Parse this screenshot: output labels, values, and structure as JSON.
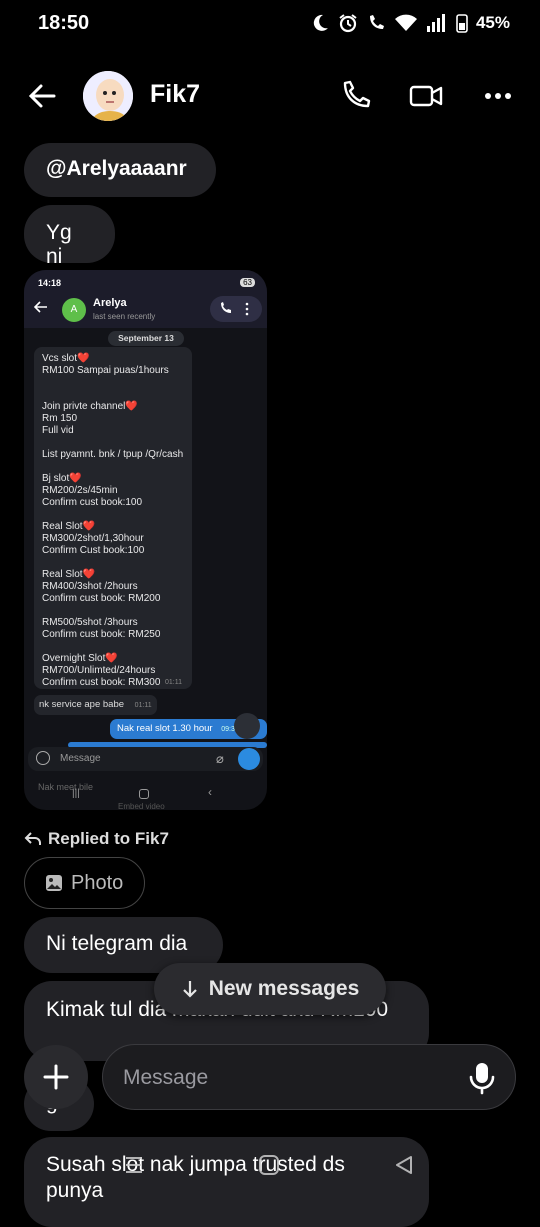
{
  "status": {
    "time": "18:50",
    "battery": "45%"
  },
  "header": {
    "contact_name": "Fik7"
  },
  "messages": {
    "m1": "@Arelyaaaanr",
    "m2": "Yg ni",
    "replied_label": "Replied to Fik7",
    "photo_label": "Photo",
    "m3": "Ni telegram dia",
    "m4": "Kimak tul dia makan duit aku Rm100",
    "m5": "g",
    "m6": "Susah slot nak jumpa trusted ds punya"
  },
  "embedded_screenshot": {
    "time": "14:18",
    "battery": "63",
    "chat_name": "Arelya",
    "chat_status": "last seen recently",
    "avatar_letter": "A",
    "date_chip": "September 13",
    "menu_text": "Vcs slot❤️\nRM100 Sampai puas/1hours\n\n\nJoin privte channel❤️\nRm 150\nFull vid\n\nList pyamnt. bnk / tpup /Qr/cash\n\nBj slot❤️\nRM200/2s/45min\nConfirm cust book:100\n\nReal Slot❤️\nRM300/2shot/1,30hour\nConfirm Cust book:100\n\nReal Slot❤️\nRM400/3shot /2hours\nConfirm cust book: RM200\n\nRM500/5shot /3hours\nConfirm cust book: RM250\n\nOvernight Slot❤️\nRM700/Unlimted/24hours\nConfirm cust book: RM300",
    "menu_time": "01:11",
    "reply_text": "nk service ape babe",
    "reply_time": "01:11",
    "out_text": "Nak real slot 1.30 hour",
    "out_time": "09:3",
    "input_placeholder": "Message",
    "under_text": "Nak meet bile",
    "under_text2": "Embed video"
  },
  "overlay": {
    "new_messages": "New messages"
  },
  "composer": {
    "placeholder": "Message"
  }
}
